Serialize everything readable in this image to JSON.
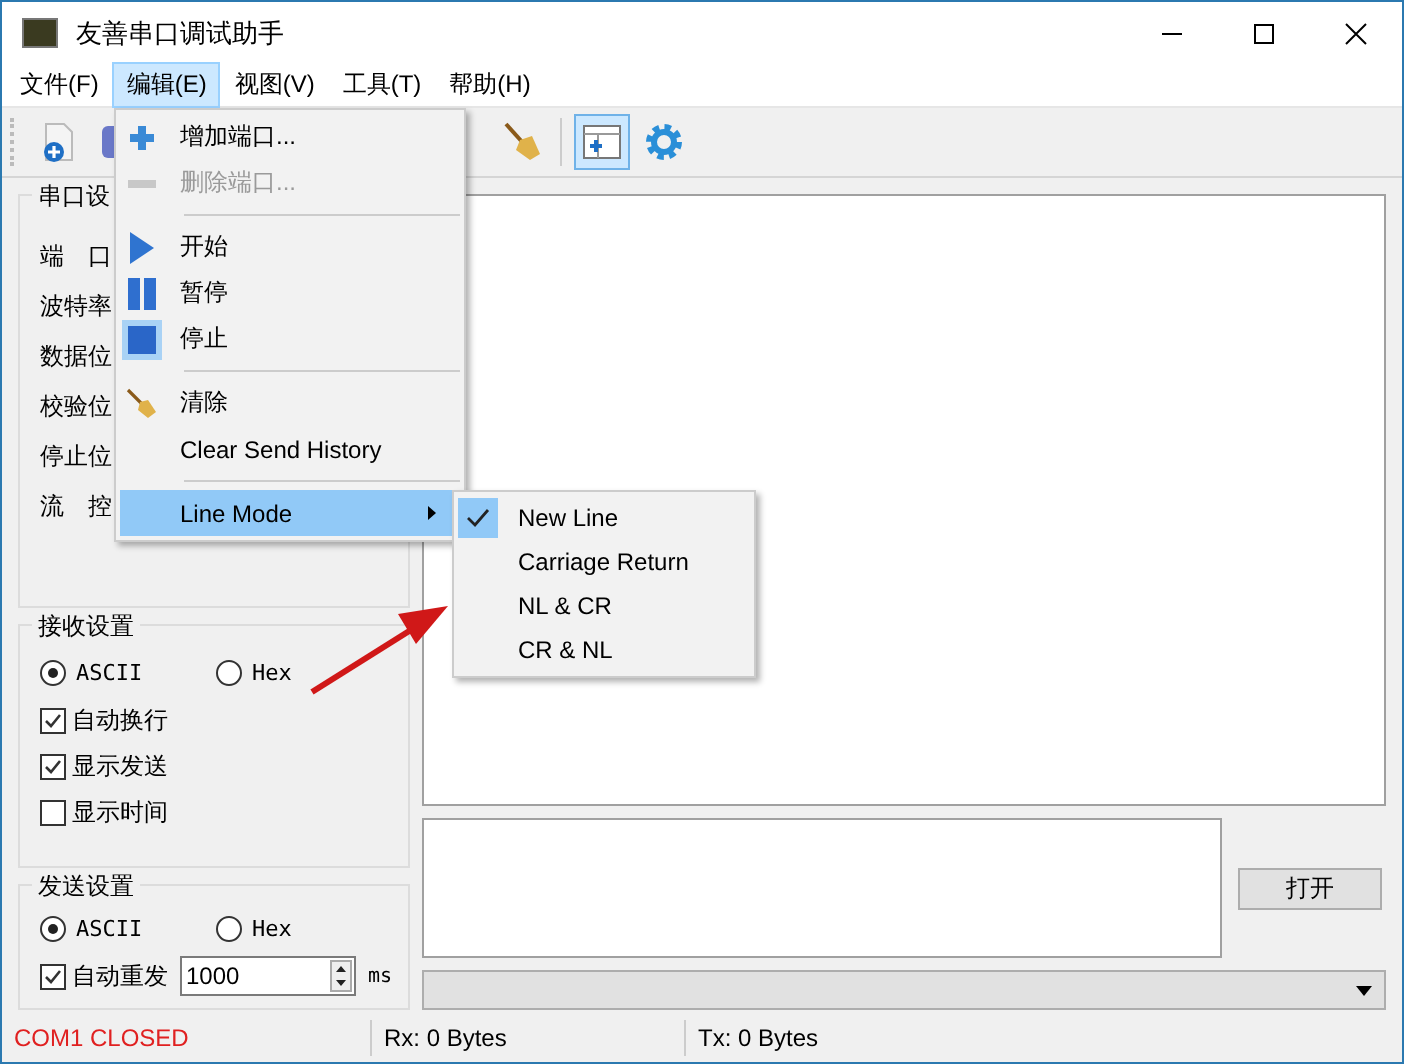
{
  "window": {
    "title": "友善串口调试助手"
  },
  "menu_bar": [
    {
      "label": "文件(F)",
      "selected": false
    },
    {
      "label": "编辑(E)",
      "selected": true
    },
    {
      "label": "视图(V)",
      "selected": false
    },
    {
      "label": "工具(T)",
      "selected": false
    },
    {
      "label": "帮助(H)",
      "selected": false
    }
  ],
  "toolbar": [
    {
      "kind": "new",
      "selected": false
    },
    {
      "kind": "log",
      "selected": false
    },
    {
      "kind": "broom",
      "selected": false
    },
    {
      "kind": "window",
      "selected": true
    },
    {
      "kind": "gear",
      "selected": false
    }
  ],
  "edit_menu": [
    {
      "kind": "item",
      "label": "增加端口...",
      "disabled": false,
      "selected": false
    },
    {
      "kind": "item",
      "label": "删除端口...",
      "disabled": true,
      "selected": false
    },
    {
      "kind": "separator"
    },
    {
      "kind": "item",
      "label": "开始",
      "disabled": false,
      "selected": false
    },
    {
      "kind": "item",
      "label": "暂停",
      "disabled": false,
      "selected": false
    },
    {
      "kind": "item",
      "label": "停止",
      "disabled": false,
      "selected": false
    },
    {
      "kind": "separator"
    },
    {
      "kind": "item",
      "label": "清除",
      "disabled": false,
      "selected": false
    },
    {
      "kind": "item",
      "label": "Clear Send History",
      "disabled": false,
      "selected": false
    },
    {
      "kind": "separator"
    },
    {
      "kind": "submenu",
      "label": "Line Mode",
      "disabled": false,
      "selected": true
    }
  ],
  "line_mode_menu": [
    {
      "label": "New Line",
      "checked": true
    },
    {
      "label": "Carriage Return",
      "checked": false
    },
    {
      "label": "NL & CR",
      "checked": false
    },
    {
      "label": "CR & NL",
      "checked": false
    }
  ],
  "serial_settings": {
    "title": "串口设",
    "fields": [
      "端　口",
      "波特率",
      "数据位",
      "校验位",
      "停止位",
      "流　控"
    ]
  },
  "receive_settings": {
    "title": "接收设置",
    "encoding": [
      {
        "label": "ASCII",
        "selected": true
      },
      {
        "label": "Hex",
        "selected": false
      }
    ],
    "options": [
      {
        "label": "自动换行",
        "checked": true
      },
      {
        "label": "显示发送",
        "checked": true
      },
      {
        "label": "显示时间",
        "checked": false
      }
    ]
  },
  "send_settings": {
    "title": "发送设置",
    "encoding": [
      {
        "label": "ASCII",
        "selected": true
      },
      {
        "label": "Hex",
        "selected": false
      }
    ],
    "auto_resend": {
      "label": "自动重发",
      "checked": true,
      "value": "1000",
      "unit": "ms"
    }
  },
  "open_button": "打开",
  "status_bar": {
    "port": "COM1 CLOSED",
    "rx": "Rx: 0 Bytes",
    "tx": "Tx: 0 Bytes"
  }
}
